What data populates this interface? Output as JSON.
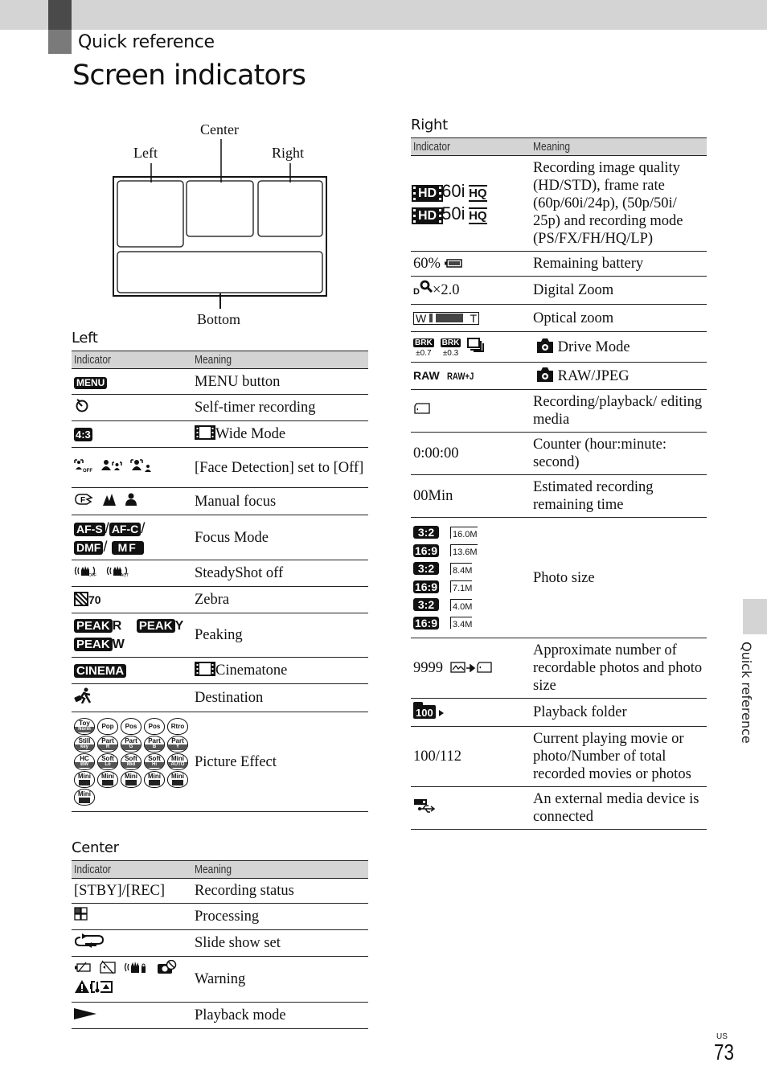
{
  "header": {
    "section": "Quick reference",
    "title": "Screen indicators"
  },
  "diagram": {
    "labels": {
      "left": "Left",
      "center": "Center",
      "right": "Right",
      "bottom": "Bottom"
    }
  },
  "table_headers": {
    "indicator": "Indicator",
    "meaning": "Meaning"
  },
  "left": {
    "caption": "Left",
    "rows": [
      {
        "indicator_icons": [
          "menu-icon"
        ],
        "indicator_text": "MENU",
        "meaning": "MENU button"
      },
      {
        "indicator_icons": [
          "self-timer-icon"
        ],
        "meaning": "Self-timer recording"
      },
      {
        "indicator_icons": [
          "aspect-4-3-icon"
        ],
        "indicator_text": "4:3",
        "meaning_icon": "movie-film-icon",
        "meaning": "Wide Mode"
      },
      {
        "indicator_icons": [
          "face-detection-off-icon",
          "face-detection-priority-icon",
          "face-detection-on-icon"
        ],
        "meaning": "[Face Detection] set to [Off]"
      },
      {
        "indicator_icons": [
          "manual-focus-icon",
          "mountain-icon",
          "person-icon"
        ],
        "meaning": "Manual focus"
      },
      {
        "indicator_items": [
          "AF-S",
          "AF-C",
          "DMF",
          "MF"
        ],
        "meaning": "Focus Mode"
      },
      {
        "indicator_icons": [
          "steadyshot-off-icon",
          "steadyshot-active-icon"
        ],
        "meaning": "SteadyShot off"
      },
      {
        "indicator_icons": [
          "zebra-icon"
        ],
        "indicator_text": "70",
        "meaning": "Zebra"
      },
      {
        "indicator_items": [
          "PEAK R",
          "PEAK Y",
          "PEAK W"
        ],
        "meaning": "Peaking"
      },
      {
        "indicator_items": [
          "CINEMA"
        ],
        "meaning_icon": "movie-film-icon",
        "meaning": "Cinematone"
      },
      {
        "indicator_icons": [
          "destination-traveler-icon"
        ],
        "meaning": "Destination"
      },
      {
        "indicator_items": [
          {
            "top": "Toy",
            "sub": "Norm"
          },
          {
            "top": "Pop",
            "sub": ""
          },
          {
            "top": "Pos",
            "sub": ""
          },
          {
            "top": "Pos",
            "sub": ""
          },
          {
            "top": "Rtro",
            "sub": ""
          },
          {
            "top": "Still",
            "sub": "key"
          },
          {
            "top": "Part",
            "sub": "R"
          },
          {
            "top": "Part",
            "sub": "G"
          },
          {
            "top": "Part",
            "sub": "B"
          },
          {
            "top": "Part",
            "sub": "Y"
          },
          {
            "top": "HC",
            "sub": "BW"
          },
          {
            "top": "Soft",
            "sub": "Lo"
          },
          {
            "top": "Soft",
            "sub": "Mid"
          },
          {
            "top": "Soft",
            "sub": "Hi"
          },
          {
            "top": "Mini",
            "sub": "AUTO"
          },
          {
            "top": "Mini",
            "sub": ""
          },
          {
            "top": "Mini",
            "sub": ""
          },
          {
            "top": "Mini",
            "sub": ""
          },
          {
            "top": "Mini",
            "sub": ""
          },
          {
            "top": "Mini",
            "sub": ""
          },
          {
            "top": "Mini",
            "sub": ""
          }
        ],
        "meaning": "Picture Effect"
      }
    ]
  },
  "center": {
    "caption": "Center",
    "rows": [
      {
        "indicator_text": "[STBY]/[REC]",
        "meaning": "Recording status"
      },
      {
        "indicator_icons": [
          "processing-icon"
        ],
        "meaning": "Processing"
      },
      {
        "indicator_icons": [
          "slide-show-repeat-icon"
        ],
        "meaning": "Slide show set"
      },
      {
        "indicator_icons": [
          "battery-warning-icon",
          "media-warning-icon",
          "steadyshot-warning-icon",
          "camera-warning-icon",
          "temperature-warning-icon"
        ],
        "meaning": "Warning"
      },
      {
        "indicator_icons": [
          "play-icon"
        ],
        "meaning": "Playback mode"
      }
    ]
  },
  "right": {
    "caption": "Right",
    "rows": [
      {
        "indicator_items": [
          "HD 60i HQ",
          "HD 50i HQ"
        ],
        "hd_label": "HD",
        "rates": [
          "60i",
          "50i"
        ],
        "mode": "HQ",
        "meaning": "Recording image quality (HD/STD), frame rate (60p/60i/24p), (50p/50i/ 25p) and recording mode (PS/FX/FH/HQ/LP)"
      },
      {
        "indicator_text": "60%",
        "indicator_icons": [
          "battery-icon"
        ],
        "battery_level_percent": 60,
        "meaning": "Remaining battery"
      },
      {
        "indicator_prefix": "D",
        "indicator_icons": [
          "magnifier-icon"
        ],
        "indicator_text": "×2.0",
        "meaning": "Digital Zoom"
      },
      {
        "indicator_icons": [
          "optical-zoom-bar-icon"
        ],
        "wide_label": "W",
        "tele_label": "T",
        "meaning": "Optical zoom"
      },
      {
        "indicator_items": [
          {
            "label": "BRK",
            "sub": "±0.7"
          },
          {
            "label": "BRK",
            "sub": "±0.3"
          }
        ],
        "indicator_icons": [
          "continuous-shooting-icon"
        ],
        "meaning_icon": "camera-icon",
        "meaning": "Drive Mode"
      },
      {
        "indicator_items": [
          "RAW",
          "RAW+J"
        ],
        "meaning_icon": "camera-icon",
        "meaning": "RAW/JPEG"
      },
      {
        "indicator_icons": [
          "memory-card-icon"
        ],
        "meaning": "Recording/playback/ editing media"
      },
      {
        "indicator_text": "0:00:00",
        "meaning": "Counter (hour:minute: second)"
      },
      {
        "indicator_text": "00Min",
        "meaning": "Estimated recording remaining time"
      },
      {
        "indicator_items": [
          {
            "ratio": "3:2",
            "size": "16.0M"
          },
          {
            "ratio": "16:9",
            "size": "13.6M"
          },
          {
            "ratio": "3:2",
            "size": "8.4M"
          },
          {
            "ratio": "16:9",
            "size": "7.1M"
          },
          {
            "ratio": "3:2",
            "size": "4.0M"
          },
          {
            "ratio": "16:9",
            "size": "3.4M"
          }
        ],
        "meaning": "Photo size"
      },
      {
        "indicator_text": "9999",
        "indicator_icons": [
          "photo-icon",
          "arrow-right-icon",
          "memory-card-icon"
        ],
        "meaning": "Approximate number of recordable photos and photo size"
      },
      {
        "indicator_text": "100",
        "indicator_icons": [
          "folder-icon",
          "play-small-icon"
        ],
        "meaning": "Playback folder"
      },
      {
        "indicator_text": "100/112",
        "meaning": "Current playing movie or photo/Number of total recorded movies or photos"
      },
      {
        "indicator_icons": [
          "usb-media-icon"
        ],
        "meaning": "An external media device is connected"
      }
    ]
  },
  "sidebar": {
    "tab_label": "Quick reference"
  },
  "footer": {
    "region": "US",
    "page_number": "73"
  }
}
